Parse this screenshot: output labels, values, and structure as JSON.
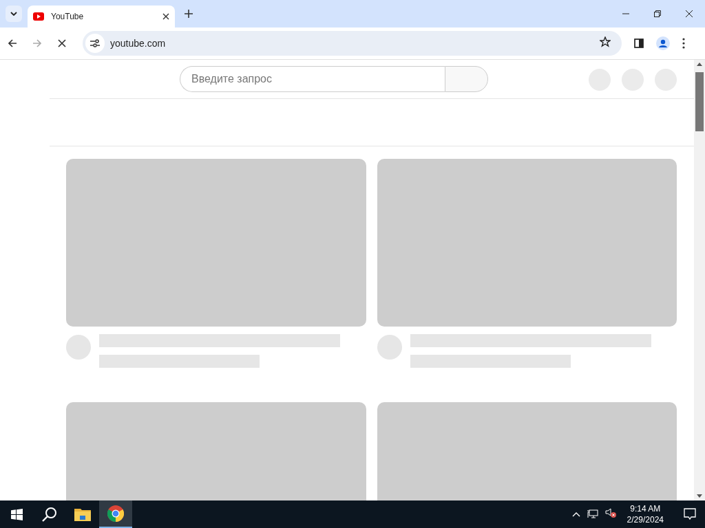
{
  "browser": {
    "tabs": [
      {
        "title": "YouTube",
        "selected": true
      }
    ],
    "loading": true,
    "address": "youtube.com",
    "bookmarked": false
  },
  "page": {
    "search": {
      "placeholder": "Введите запрос"
    }
  },
  "taskbar": {
    "apps": [
      {
        "kind": "explorer",
        "selected": false
      },
      {
        "kind": "chrome",
        "selected": true
      }
    ],
    "volume_muted": true,
    "time": "9:14 AM",
    "date": "2/29/2024"
  }
}
